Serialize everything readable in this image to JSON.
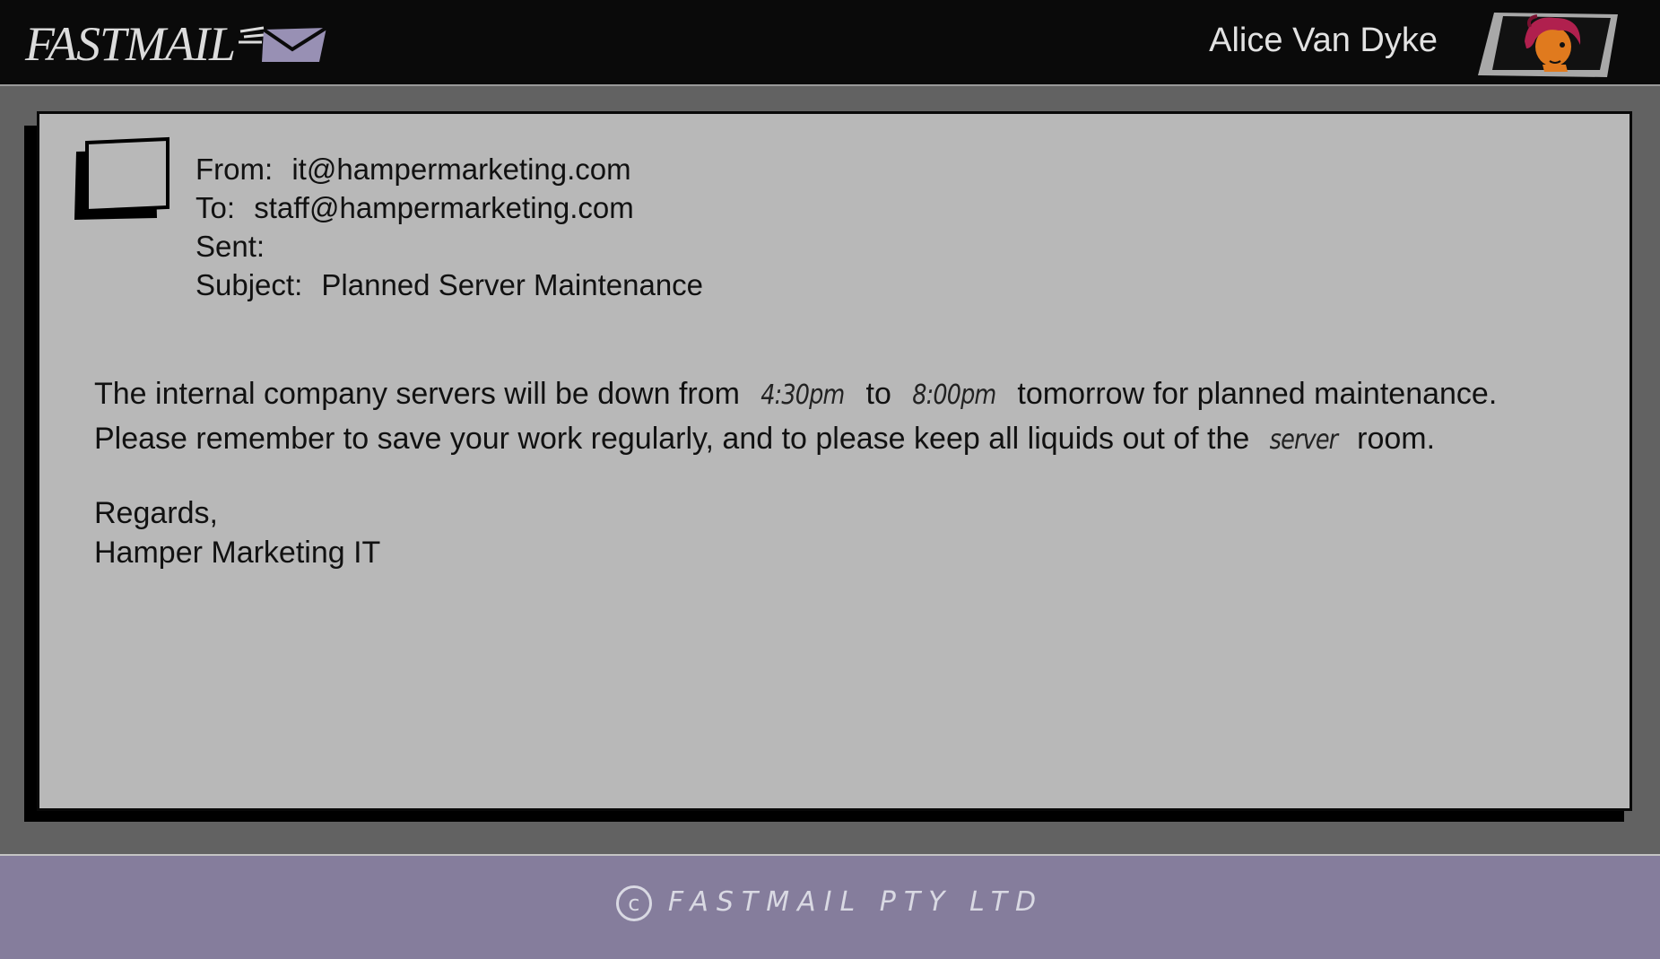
{
  "app": {
    "logo_text": "FASTMAIL"
  },
  "user": {
    "name": "Alice Van Dyke",
    "avatar_icon": "user-avatar-portrait"
  },
  "email": {
    "from_label": "From:",
    "from_value": "it@hampermarketing.com",
    "to_label": "To:",
    "to_value": "staff@hampermarketing.com",
    "sent_label": "Sent:",
    "sent_value": "",
    "subject_label": "Subject:",
    "subject_value": "Planned Server Maintenance",
    "body": {
      "line1_a": "The internal company servers will be down from",
      "time_start": "4:30pm",
      "line1_b": "to",
      "time_end": "8:00pm",
      "line1_c": "tomorrow for planned maintenance.",
      "line2_a": "Please remember to save your work regularly, and to please keep all liquids out of the",
      "line2_hand": "server",
      "line2_b": "room."
    },
    "signoff": "Regards,",
    "signature": "Hamper Marketing IT"
  },
  "footer": {
    "copyright_symbol": "c",
    "company": "FASTMAIL PTY LTD"
  },
  "colors": {
    "header_bg": "#0a0a0a",
    "page_bg": "#626262",
    "card_bg": "#b8b8b8",
    "footer_bg": "#857d9c",
    "envelope": "#9890b4"
  }
}
